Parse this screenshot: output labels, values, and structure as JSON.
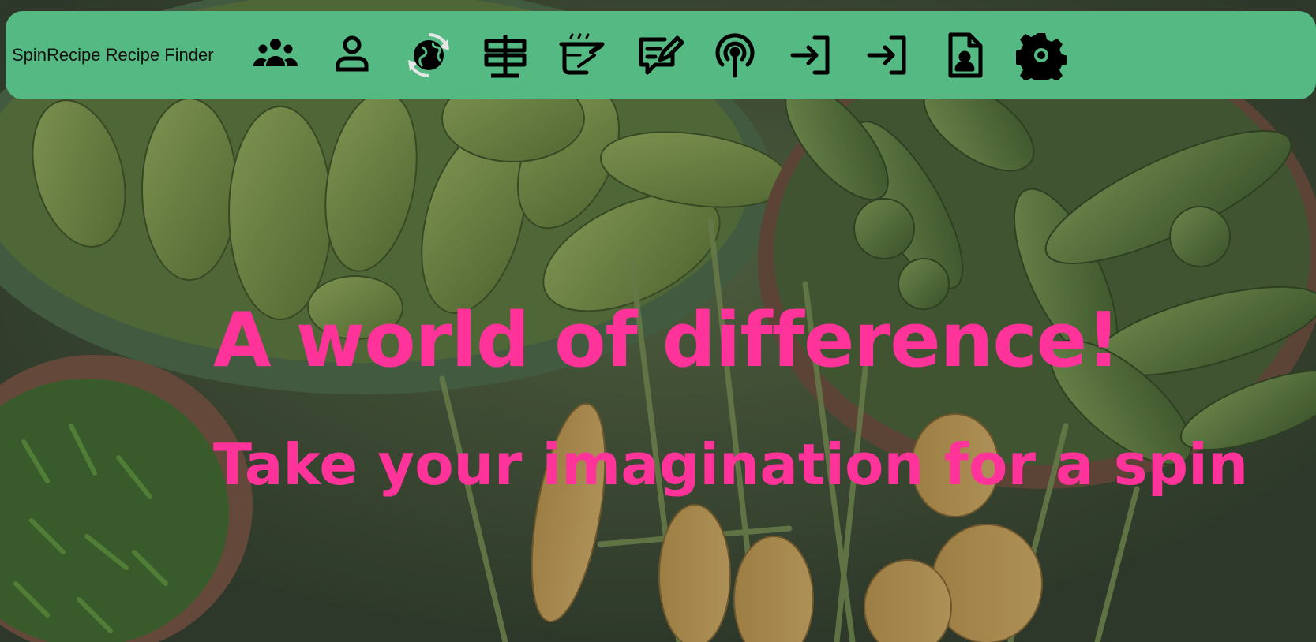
{
  "navbar": {
    "brand": "SpinRecipe Recipe Finder",
    "icons": [
      {
        "name": "community-icon"
      },
      {
        "name": "profile-icon"
      },
      {
        "name": "globe-refresh-icon"
      },
      {
        "name": "signpost-icon"
      },
      {
        "name": "cooking-icon"
      },
      {
        "name": "write-review-icon"
      },
      {
        "name": "podcast-icon"
      },
      {
        "name": "login-icon"
      },
      {
        "name": "signup-icon"
      },
      {
        "name": "account-file-icon"
      },
      {
        "name": "settings-icon"
      }
    ]
  },
  "hero": {
    "headline": "A world of difference!",
    "tagline": "Take your imagination for a spin"
  },
  "colors": {
    "navbar": "#55b983",
    "hero_text": "#ff3399"
  }
}
